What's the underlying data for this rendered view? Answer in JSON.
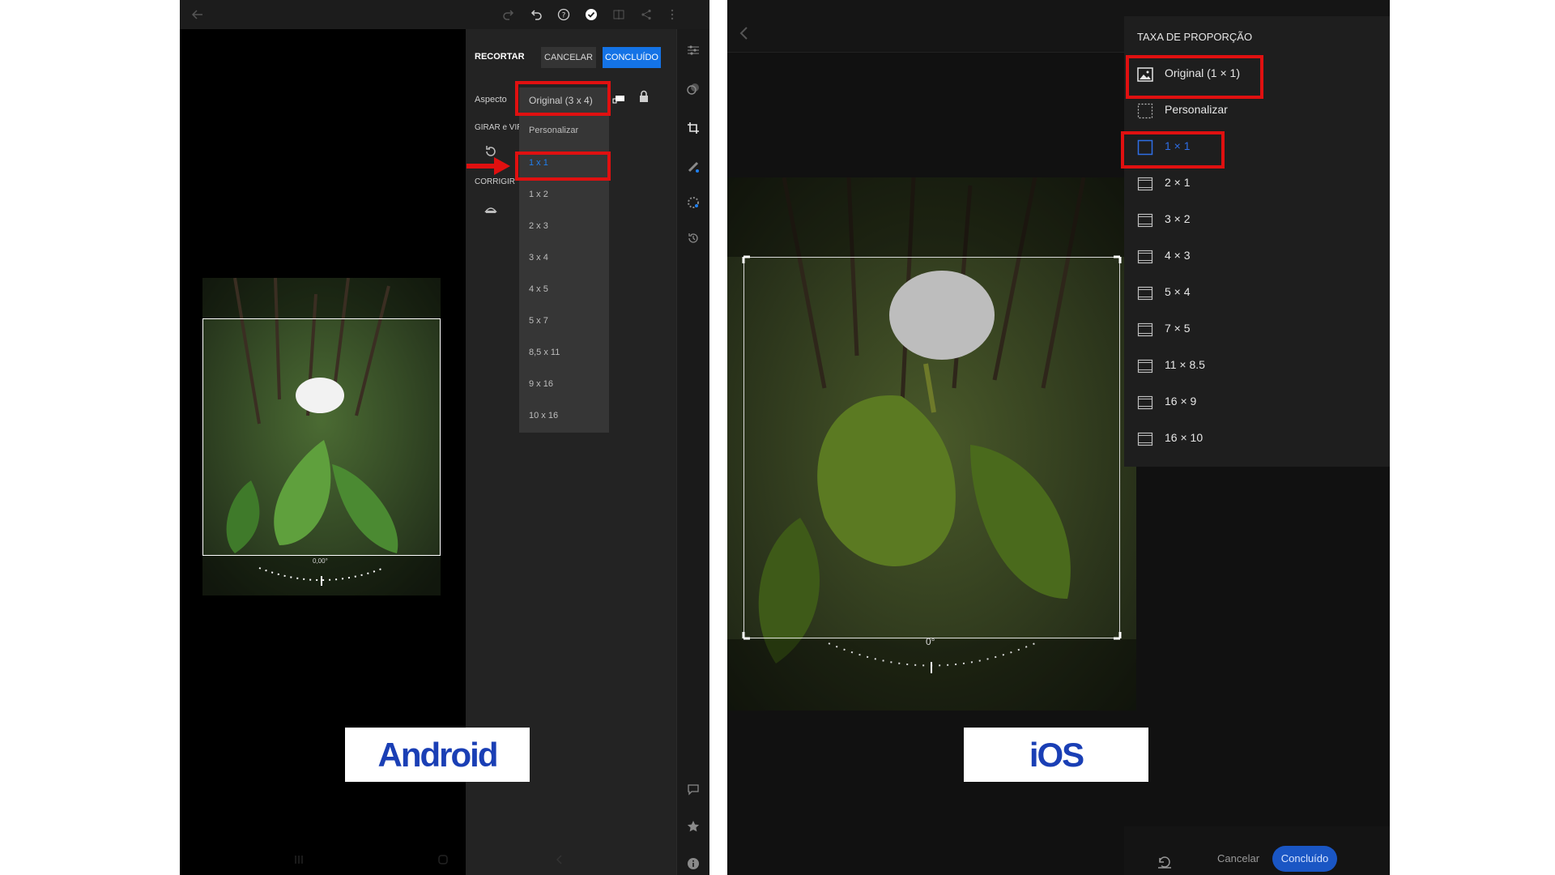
{
  "android": {
    "title": "RECORTAR",
    "cancel_label": "CANCELAR",
    "done_label": "CONCLUÍDO",
    "aspect_label": "Aspecto",
    "aspect_selected": "Original (3 x 4)",
    "rotate_label": "GIRAR e VIR",
    "correct_label": "CORRIGIR",
    "dropdown_items": [
      "Personalizar",
      "1 x 1",
      "1 x 2",
      "2 x 3",
      "3 x 4",
      "4 x 5",
      "5 x 7",
      "8,5 x 11",
      "9 x 16",
      "10 x 16"
    ],
    "selected_item": "1 x 1",
    "angle_readout": "0,00°",
    "platform_label": "Android"
  },
  "ios": {
    "menu_title": "TAXA DE PROPORÇÃO",
    "menu_items": [
      "Original (1 × 1)",
      "Personalizar",
      "1 × 1",
      "2 × 1",
      "3 × 2",
      "4 × 3",
      "5 × 4",
      "7 × 5",
      "11 × 8.5",
      "16 × 9",
      "16 × 10"
    ],
    "selected_item": "1 × 1",
    "angle_readout": "0°",
    "cancel_label": "Cancelar",
    "done_label": "Concluído",
    "platform_label": "iOS"
  },
  "colors": {
    "accent_blue": "#1473e6",
    "highlight_red": "#e01010",
    "label_blue": "#1a3fb5"
  }
}
